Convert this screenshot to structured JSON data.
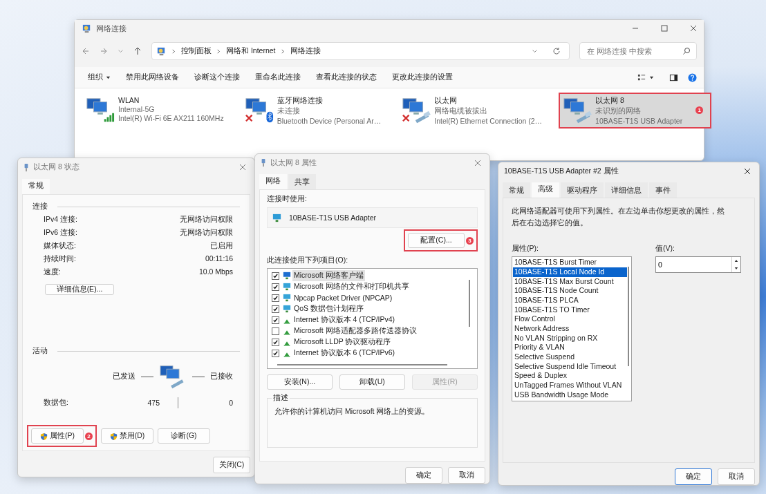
{
  "explorer": {
    "title": "网络连接",
    "breadcrumbs": [
      "控制面板",
      "网络和 Internet",
      "网络连接"
    ],
    "search": {
      "placeholder": "在 网络连接 中搜索"
    },
    "toolbar": [
      {
        "label": "组织",
        "dropdown": true
      },
      {
        "label": "禁用此网络设备",
        "dropdown": false
      },
      {
        "label": "诊断这个连接",
        "dropdown": false
      },
      {
        "label": "重命名此连接",
        "dropdown": false
      },
      {
        "label": "查看此连接的状态",
        "dropdown": false
      },
      {
        "label": "更改此连接的设置",
        "dropdown": false
      }
    ],
    "connections": [
      {
        "name": "WLAN",
        "status": "Internal-5G",
        "device": "Intel(R) Wi-Fi 6E AX211 160MHz",
        "kind": "wifi",
        "disconnected": false,
        "selected": false,
        "highlighted": false
      },
      {
        "name": "蓝牙网络连接",
        "status": "未连接",
        "device": "Bluetooth Device (Personal Ar…",
        "kind": "bluetooth",
        "disconnected": true,
        "selected": false,
        "highlighted": false
      },
      {
        "name": "以太网",
        "status": "网络电缆被拔出",
        "device": "Intel(R) Ethernet Connection (2…",
        "kind": "ethernet",
        "disconnected": true,
        "selected": false,
        "highlighted": false
      },
      {
        "name": "以太网 8",
        "status": "未识别的网络",
        "device": "10BASE-T1S USB Adapter",
        "kind": "ethernet",
        "disconnected": false,
        "selected": true,
        "highlighted": true,
        "badge": "1"
      }
    ]
  },
  "status_dialog": {
    "title": "以太网 8 状态",
    "tabs": [
      {
        "label": "常规",
        "selected": true
      }
    ],
    "connection_heading": "连接",
    "rows": [
      {
        "label": "IPv4 连接:",
        "value": "无网络访问权限"
      },
      {
        "label": "IPv6 连接:",
        "value": "无网络访问权限"
      },
      {
        "label": "媒体状态:",
        "value": "已启用"
      },
      {
        "label": "持续时间:",
        "value": "00:11:16"
      },
      {
        "label": "速度:",
        "value": "10.0 Mbps"
      }
    ],
    "details_button": "详细信息(E)...",
    "activity_heading": "活动",
    "sent_label": "已发送",
    "received_label": "已接收",
    "packets_label": "数据包:",
    "packets_sent": "475",
    "packets_received": "0",
    "buttons": [
      {
        "label": "属性(P)",
        "shield": true,
        "highlighted": true,
        "badge": "2"
      },
      {
        "label": "禁用(D)",
        "shield": true,
        "highlighted": false
      },
      {
        "label": "诊断(G)",
        "shield": false,
        "highlighted": false
      }
    ],
    "close_button": "关闭(C)"
  },
  "properties_dialog": {
    "title": "以太网 8 属性",
    "tabs": [
      {
        "label": "网络",
        "selected": true
      },
      {
        "label": "共享",
        "selected": false
      }
    ],
    "connect_using_label": "连接时使用:",
    "adapter": "10BASE-T1S USB Adapter",
    "configure_button": {
      "label": "配置(C)...",
      "highlighted": true,
      "badge": "3"
    },
    "items_label": "此连接使用下列项目(O):",
    "items": [
      {
        "label": "Microsoft 网络客户端",
        "checked": true,
        "kind": "client",
        "selected": true
      },
      {
        "label": "Microsoft 网络的文件和打印机共享",
        "checked": true,
        "kind": "service",
        "selected": false
      },
      {
        "label": "Npcap Packet Driver (NPCAP)",
        "checked": true,
        "kind": "service",
        "selected": false
      },
      {
        "label": "QoS 数据包计划程序",
        "checked": true,
        "kind": "service",
        "selected": false
      },
      {
        "label": "Internet 协议版本 4 (TCP/IPv4)",
        "checked": true,
        "kind": "protocol",
        "selected": false
      },
      {
        "label": "Microsoft 网络适配器多路传送器协议",
        "checked": false,
        "kind": "protocol",
        "selected": false
      },
      {
        "label": "Microsoft LLDP 协议驱动程序",
        "checked": true,
        "kind": "protocol",
        "selected": false
      },
      {
        "label": "Internet 协议版本 6 (TCP/IPv6)",
        "checked": true,
        "kind": "protocol",
        "selected": false
      }
    ],
    "item_buttons": [
      {
        "label": "安装(N)...",
        "disabled": false
      },
      {
        "label": "卸载(U)",
        "disabled": false
      },
      {
        "label": "属性(R)",
        "disabled": true
      }
    ],
    "description_heading": "描述",
    "description": "允许你的计算机访问 Microsoft 网络上的资源。",
    "ok_button": "确定",
    "cancel_button": "取消"
  },
  "adapter_dialog": {
    "title": "10BASE-T1S USB Adapter #2 属性",
    "tabs": [
      {
        "label": "常规",
        "selected": false
      },
      {
        "label": "高级",
        "selected": true
      },
      {
        "label": "驱动程序",
        "selected": false
      },
      {
        "label": "详细信息",
        "selected": false
      },
      {
        "label": "事件",
        "selected": false
      }
    ],
    "intro": "此网络适配器可使用下列属性。在左边单击你想更改的属性，然后在右边选择它的值。",
    "property_label": "属性(P):",
    "value_label": "值(V):",
    "value": "0",
    "properties": [
      {
        "label": "10BASE-T1S Burst Timer",
        "selected": false
      },
      {
        "label": "10BASE-T1S Local Node Id",
        "selected": true
      },
      {
        "label": "10BASE-T1S Max Burst Count",
        "selected": false
      },
      {
        "label": "10BASE-T1S Node Count",
        "selected": false
      },
      {
        "label": "10BASE-T1S PLCA",
        "selected": false
      },
      {
        "label": "10BASE-T1S TO Timer",
        "selected": false
      },
      {
        "label": "Flow Control",
        "selected": false
      },
      {
        "label": "Network Address",
        "selected": false
      },
      {
        "label": "No VLAN Stripping on RX",
        "selected": false
      },
      {
        "label": "Priority & VLAN",
        "selected": false
      },
      {
        "label": "Selective Suspend",
        "selected": false
      },
      {
        "label": "Selective Suspend Idle Timeout",
        "selected": false
      },
      {
        "label": "Speed & Duplex",
        "selected": false
      },
      {
        "label": "UnTagged Frames Without VLAN",
        "selected": false
      },
      {
        "label": "USB Bandwidth Usage Mode",
        "selected": false
      }
    ],
    "ok_button": "确定",
    "cancel_button": "取消"
  }
}
